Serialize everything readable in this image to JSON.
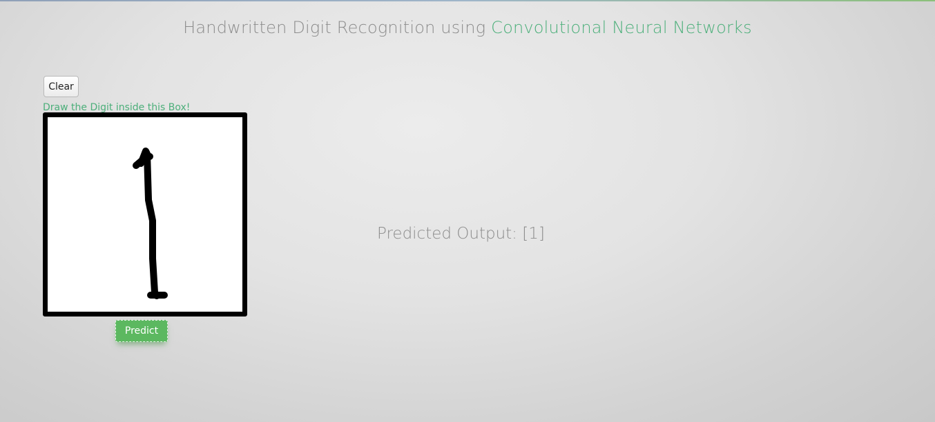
{
  "page": {
    "title_prefix": "Handwritten Digit Recognition using ",
    "title_accent": "Convolutional Neural Networks"
  },
  "controls": {
    "clear_label": "Clear",
    "draw_hint": "Draw the Digit inside this Box!",
    "predict_label": "Predict"
  },
  "result": {
    "prefix": "Predicted Output: ",
    "value": "[1]"
  },
  "colors": {
    "accent": "#4caf7a",
    "predict_button": "#5cb860",
    "text_muted": "#8c8c8c",
    "canvas_border": "#000000",
    "stroke": "#000000"
  },
  "icons": {
    "drawing": "handwritten-digit-stroke"
  }
}
